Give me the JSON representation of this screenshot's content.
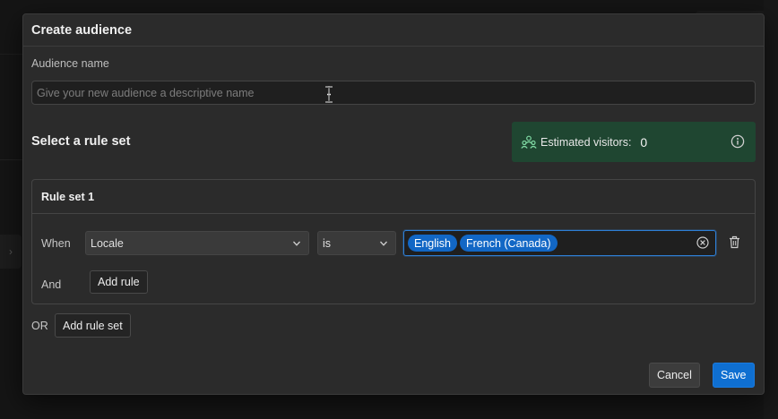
{
  "modal": {
    "title": "Create audience"
  },
  "audience_name": {
    "label": "Audience name",
    "value": "",
    "placeholder": "Give your new audience a descriptive name"
  },
  "rules": {
    "section_title": "Select a rule set",
    "estimate": {
      "label": "Estimated visitors:",
      "count": "0",
      "icon": "people-icon"
    },
    "rule_sets": [
      {
        "title": "Rule set 1",
        "when_label": "When",
        "property": "Locale",
        "operator": "is",
        "values": [
          "English",
          "French (Canada)"
        ],
        "and_label": "And",
        "add_rule_label": "Add rule"
      }
    ],
    "or_label": "OR",
    "add_rule_set_label": "Add rule set"
  },
  "footer": {
    "cancel_label": "Cancel",
    "save_label": "Save"
  },
  "colors": {
    "modal_bg": "#2b2b2b",
    "estimate_bg": "#1f4631",
    "tag_bg": "#1267c5",
    "primary": "#0f6fd1",
    "focus_border": "#2e7fd6"
  }
}
